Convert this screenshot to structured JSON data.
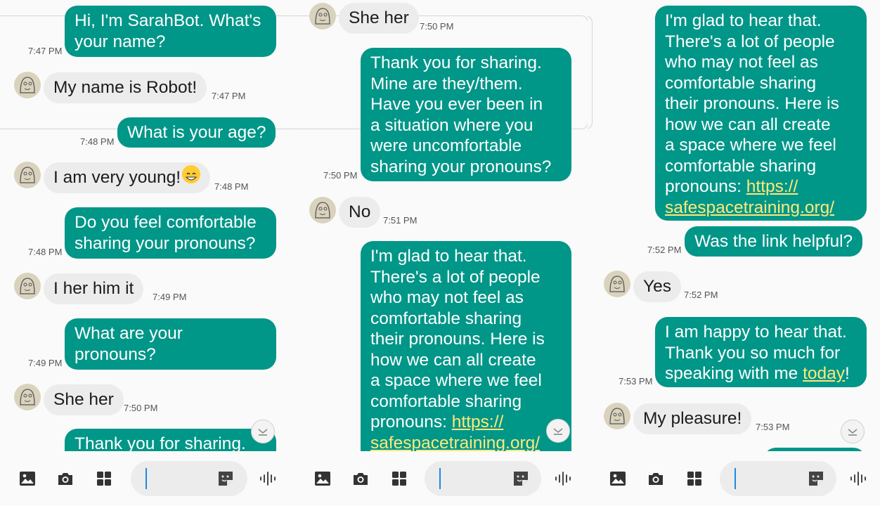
{
  "colors": {
    "outgoing": "#009688",
    "incoming": "#ececec",
    "link": "#ffe97a"
  },
  "panel1": {
    "m1_line1": "Hi, I'm SarahBot. What's",
    "m1_line2": "your name?",
    "m1_time": "7:47 PM",
    "m2_text": "My name is Robot!",
    "m2_time": "7:47 PM",
    "m3_text": "What is your age?",
    "m3_time": "7:48 PM",
    "m4_text": "I am very young!",
    "m4_time": "7:48 PM",
    "m5_line1": "Do you feel comfortable",
    "m5_line2": "sharing your pronouns?",
    "m5_time": "7:48 PM",
    "m6_text": "I her him it",
    "m6_time": "7:49 PM",
    "m7_line1": "What are your",
    "m7_line2": "pronouns?",
    "m7_time": "7:49 PM",
    "m8_text": "She her",
    "m8_time": "7:50 PM",
    "m9_partial": "Thank you for sharing."
  },
  "panel2": {
    "m1_text": "She her",
    "m1_time": "7:50 PM",
    "m2_lines": [
      "Thank you for sharing.",
      "Mine are they/them.",
      "Have you ever been in",
      "a situation where you",
      "were uncomfortable",
      "sharing your pronouns?"
    ],
    "m2_time": "7:50 PM",
    "m3_text": "No",
    "m3_time": "7:51 PM",
    "m4_lines": [
      "I'm glad to hear that.",
      "There's a lot of people",
      "who may not feel as",
      "comfortable sharing",
      "their pronouns. Here is",
      "how we can all create",
      "a space where we feel",
      "comfortable sharing"
    ],
    "m4_pre_link": "pronouns: ",
    "m4_link1": "https://",
    "m4_link2": "safespacetraining.org/"
  },
  "panel3": {
    "m1_lines": [
      "I'm glad to hear that.",
      "There's a lot of people",
      "who may not feel as",
      "comfortable sharing",
      "their pronouns. Here is",
      "how we can all create",
      "a space where we feel",
      "comfortable sharing"
    ],
    "m1_pre_link": "pronouns: ",
    "m1_link1": "https://",
    "m1_link2": "safespacetraining.org/",
    "m2_text": "Was the link helpful?",
    "m2_time": "7:52 PM",
    "m3_text": "Yes",
    "m3_time": "7:52 PM",
    "m4_line1": "I am happy to hear that.",
    "m4_line2": "Thank you so much for",
    "m4_line3_pre": "speaking with me ",
    "m4_link": "today",
    "m4_line3_post": "!",
    "m4_time": "7:53 PM",
    "m5_text": "My pleasure!",
    "m5_time": "7:53 PM"
  },
  "toolbar_icons": [
    "gallery-icon",
    "camera-icon",
    "apps-grid-icon",
    "sticker-icon",
    "voice-icon"
  ]
}
